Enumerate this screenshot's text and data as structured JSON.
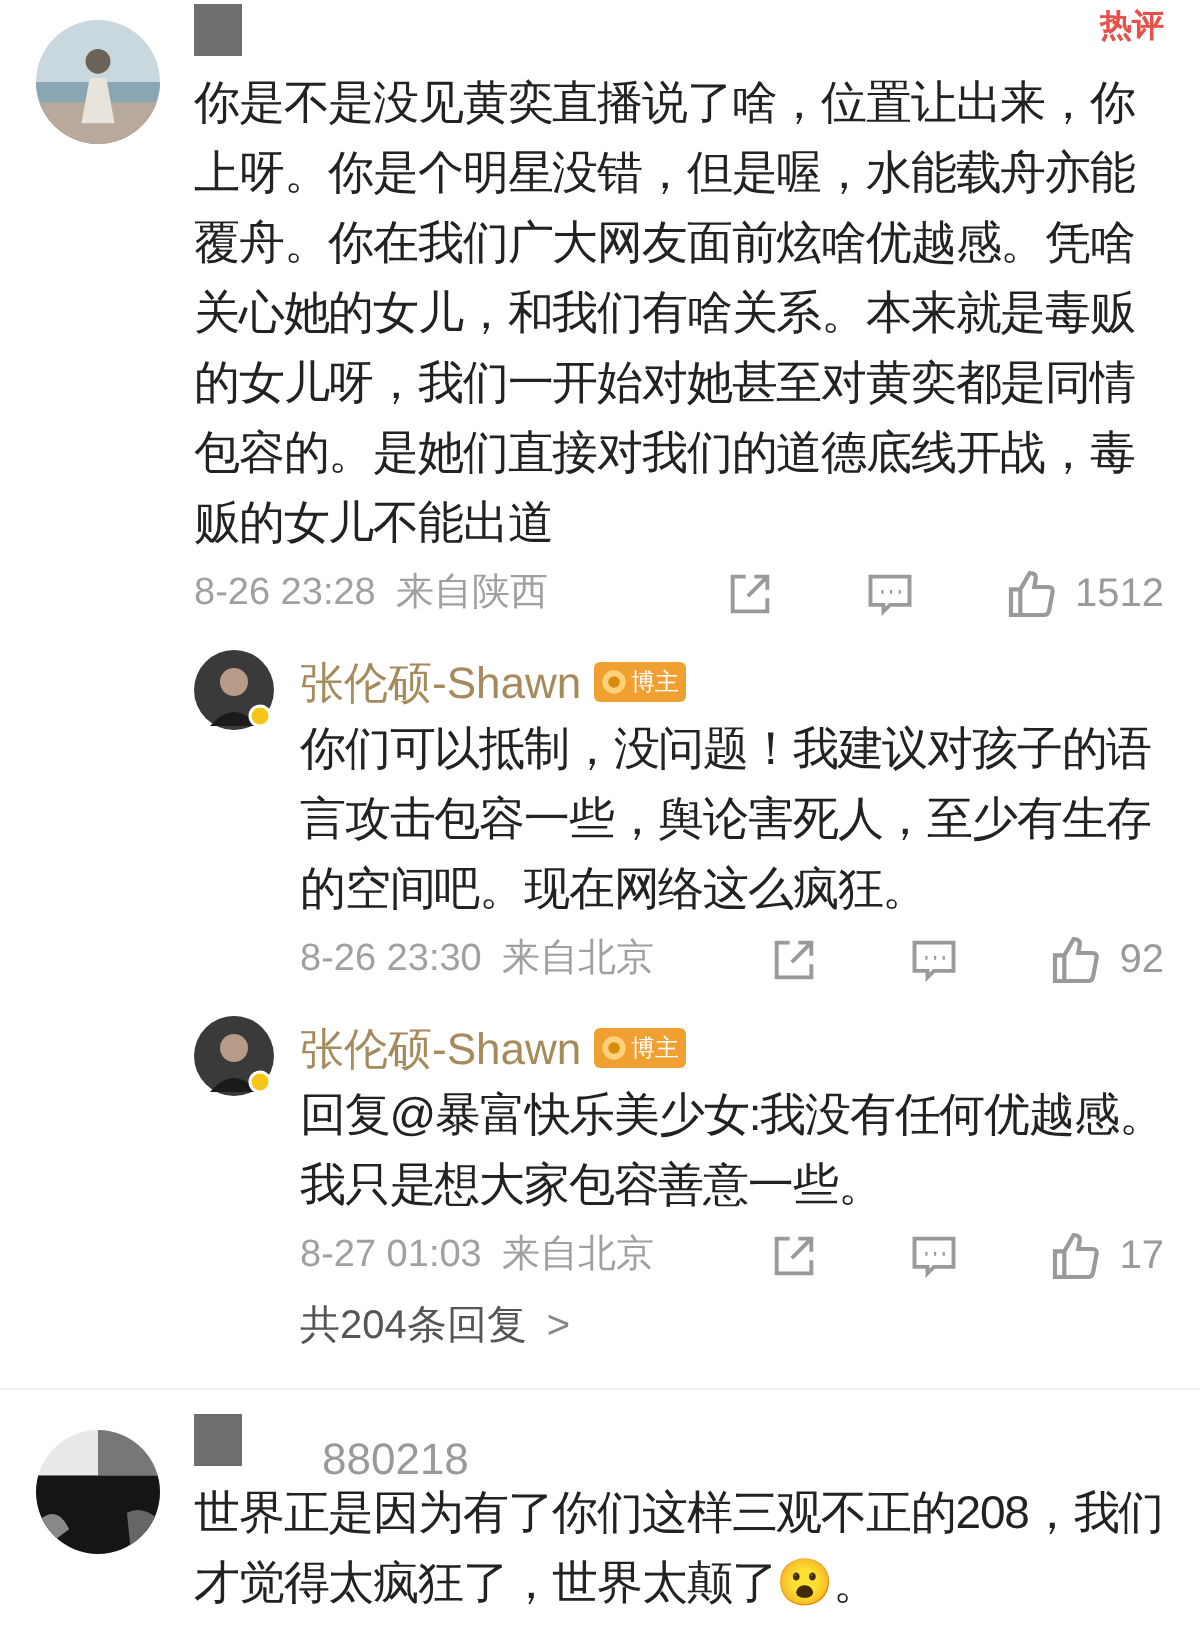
{
  "comments": [
    {
      "author_redacted": true,
      "hot_tag": "热评",
      "text": "你是不是没见黄奕直播说了啥，位置让出来，你上呀。你是个明星没错，但是喔，水能载舟亦能覆舟。你在我们广大网友面前炫啥优越感。凭啥关心她的女儿，和我们有啥关系。本来就是毒贩的女儿呀，我们一开始对她甚至对黄奕都是同情包容的。是她们直接对我们的道德底线开战，毒贩的女儿不能出道",
      "time": "8-26 23:28",
      "location": "来自陕西",
      "likes": "1512",
      "replies": [
        {
          "author": "张伦硕-Shawn",
          "badge": "博主",
          "verified": true,
          "text": "你们可以抵制，没问题！我建议对孩子的语言攻击包容一些，舆论害死人，至少有生存的空间吧。现在网络这么疯狂。",
          "time": "8-26 23:30",
          "location": "来自北京",
          "likes": "92"
        },
        {
          "author": "张伦硕-Shawn",
          "badge": "博主",
          "verified": true,
          "text": "回复@暴富快乐美少女:我没有任何优越感。我只是想大家包容善意一些。",
          "time": "8-27 01:03",
          "location": "来自北京",
          "likes": "17"
        }
      ],
      "reply_link": {
        "label": "共204条回复",
        "arrow": ">"
      }
    },
    {
      "author_redacted": true,
      "author": "880218",
      "text": "世界正是因为有了你们这样三观不正的208，我们才觉得太疯狂了，世界太颠了😮。"
    }
  ]
}
